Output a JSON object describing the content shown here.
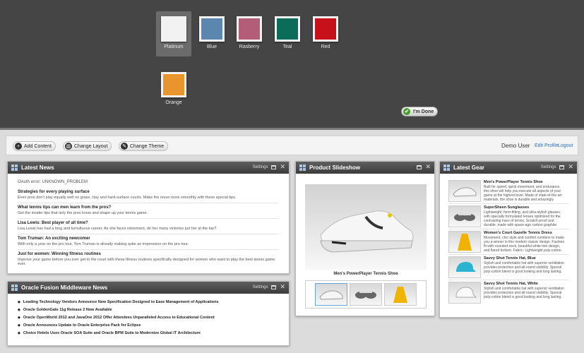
{
  "themes": [
    {
      "label": "Platinum",
      "color": "#f2f2f2",
      "selected": true
    },
    {
      "label": "Blue",
      "color": "#5b86ad"
    },
    {
      "label": "Rasberry",
      "color": "#b45d78"
    },
    {
      "label": "Teal",
      "color": "#0d6b5a"
    },
    {
      "label": "Red",
      "color": "#c8101a"
    },
    {
      "label": "Orange",
      "color": "#e8952e"
    }
  ],
  "done_label": "I'm Done",
  "toolbar": {
    "add_content": "Add Content",
    "change_layout": "Change Layout",
    "change_theme": "Change Theme",
    "user": "Demo User",
    "edit_profile": "Edit Profile",
    "logout": "Logout"
  },
  "latest_news": {
    "title": "Latest News",
    "settings": "Settings",
    "oauth": "OAuth error: UNKNOWN_PROBLEM",
    "items": [
      {
        "title": "Strategies for every playing surface",
        "desc": "Even pros don't play equally well on grass, clay and hard-surface courts. Make the move more smoothly with these special tips."
      },
      {
        "title": "What tennis tips can men learn from the pros?",
        "desc": "Get the insider tips that only the pros know and shape up your tennis game."
      },
      {
        "title": "Lisa Lewis: Best player of all time?",
        "desc": "Lisa Lewis has had a long and tumultuous career. As she faces retirement, do her many victories put her at the top?"
      },
      {
        "title": "Tom Truman: An exciting newcomer",
        "desc": "With only a year on the pro tour, Tom Truman is already making quite an impression on the pro tour."
      },
      {
        "title": "Just for women: Winning fitness routines",
        "desc": "Improve your game before you ever get to the court with these fitness routines specifically designed for women who want to play the best tennis game ever."
      }
    ]
  },
  "oracle_news": {
    "title": "Oracle Fusion Middleware News",
    "settings": "Settings",
    "items": [
      "Leading Technology Vendors Announce New Specification Designed to Ease Management of Applications",
      "Oracle GoldenGate 11g Release 2 Now Available",
      "Oracle OpenWorld 2012 and JavaOne 2012 Offer Attendees Unparalleled Access to Educational Content",
      "Oracle Announces Update to Oracle Enterprise Pack for Eclipse",
      "Choice Hotels Uses Oracle SOA Suite and Oracle BPM Suite to Modernize Global IT Architecture"
    ]
  },
  "slideshow": {
    "title": "Product Slideshow",
    "caption": "Men's PowerPlayer Tennis Shoe"
  },
  "latest_gear": {
    "title": "Latest Gear",
    "settings": "Settings",
    "items": [
      {
        "title": "Men's PowerPlayer Tennis Shoe",
        "desc": "Built for speed, quick movement, and endurance, this shoe will help you execute all aspects of your game at the highest level. Made of state-of-the-art materials, the shoe is durable and amazingly comfortable."
      },
      {
        "title": "SuperSheen Sunglasses",
        "desc": "Lightweight, form-fitting, and ultra-stylish glasses, with specially formulated lenses optimized for the contrasting hues of tennis. Scratch-proof and durable, made with space-age carbon graphite."
      },
      {
        "title": "Women's Court Gazelle Tennis Dress",
        "desc": "Movement, chic style and comfort combine to make you a winner in this modern classic design. Fashion fit with rounded-neck, beautiful white trim design, and flared bottom. Fabric: Lightweight poly-cotton."
      },
      {
        "title": "Savvy Shot Tennis Hat, Blue",
        "desc": "Stylish and comfortable hat with superior ventilation provides protection and all-round visibility. Special poly-cotton blend is good looking and long lasting."
      },
      {
        "title": "Savvy Shot Tennis Hat, White",
        "desc": "Stylish and comfortable hat with superior ventilation provides protection and all-round visibility. Special poly-cotton blend is good looking and long lasting."
      }
    ]
  }
}
